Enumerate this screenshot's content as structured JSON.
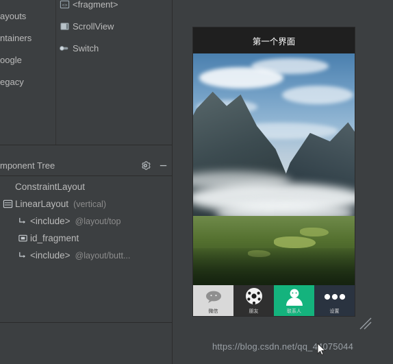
{
  "palette": {
    "groups": [
      {
        "label": "ayouts"
      },
      {
        "label": "ntainers"
      },
      {
        "label": "oogle"
      },
      {
        "label": "egacy"
      }
    ],
    "items": [
      {
        "label": "<fragment>",
        "icon": "fragment-icon"
      },
      {
        "label": "ScrollView",
        "icon": "scrollview-icon"
      },
      {
        "label": "Switch",
        "icon": "switch-icon"
      }
    ]
  },
  "component_tree": {
    "title": "mponent Tree",
    "settings_icon": "gear-icon",
    "minimize_icon": "minimize-icon",
    "rows": [
      {
        "label": "ConstraintLayout",
        "sub": "",
        "icon": "constraint-layout-icon",
        "indent": 0
      },
      {
        "label": "LinearLayout",
        "sub": "(vertical)",
        "icon": "linear-layout-icon",
        "indent": 0
      },
      {
        "label": "<include>",
        "sub": "@layout/top",
        "icon": "include-icon",
        "indent": 1
      },
      {
        "label": "id_fragment",
        "sub": "",
        "icon": "fragment-node-icon",
        "indent": 1
      },
      {
        "label": "<include>",
        "sub": "@layout/butt...",
        "icon": "include-icon",
        "indent": 1
      }
    ]
  },
  "preview": {
    "title": "第一个界面",
    "nav": [
      {
        "label": "微信",
        "icon": "chat-bubble-icon",
        "selected": true
      },
      {
        "label": "朋友",
        "icon": "friends-icon",
        "selected": false
      },
      {
        "label": "联系人",
        "icon": "contacts-icon",
        "selected": false
      },
      {
        "label": "设置",
        "icon": "settings-dots-icon",
        "selected": false
      }
    ]
  },
  "watermark": {
    "text": "https://blog.csdn.net/qq_44075044"
  },
  "colors": {
    "panel_bg": "#3c3f41",
    "text": "#bbbbbb",
    "muted_text": "#8c8c8c",
    "accent_green": "#14b37d"
  }
}
